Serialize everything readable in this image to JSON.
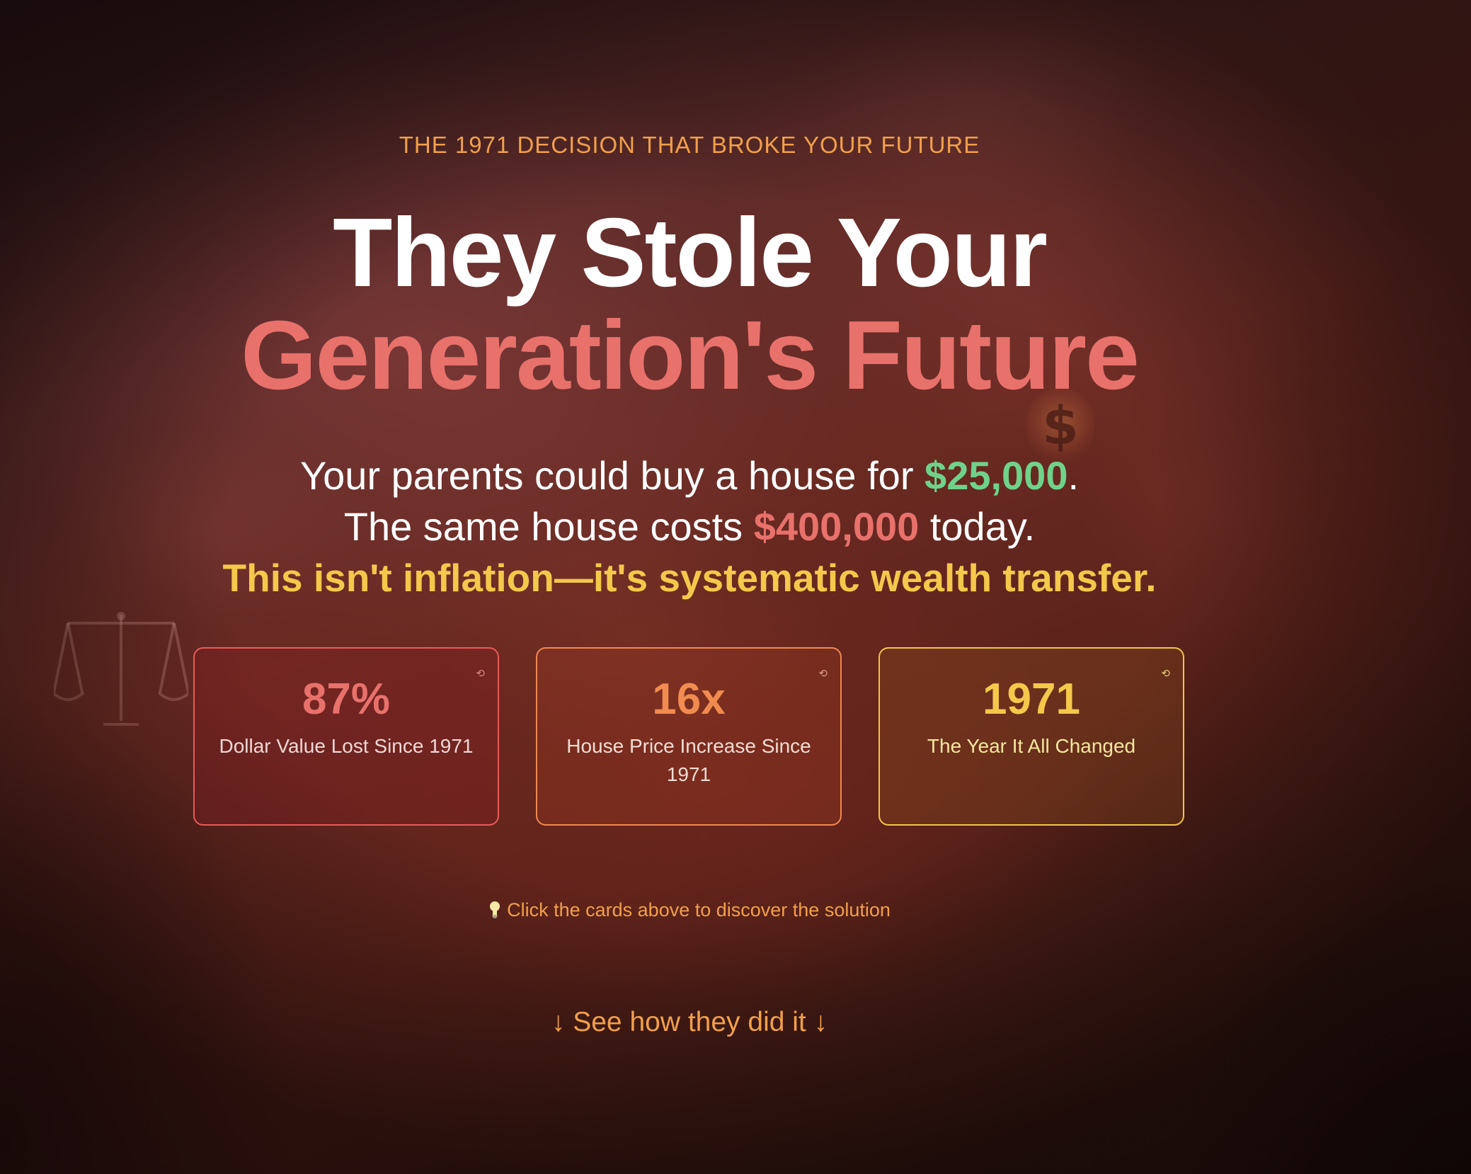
{
  "hero": {
    "eyebrow": "THE 1971 DECISION THAT BROKE YOUR FUTURE",
    "title_line1": "They Stole Your",
    "title_line2": "Generation's Future",
    "subtitle": {
      "line1_before": "Your parents could buy a house for ",
      "line1_price": "$25,000",
      "line1_after": ".",
      "line2_before": "The same house costs ",
      "line2_price": "$400,000",
      "line2_after": " today.",
      "line3": "This isn't inflation—it's systematic wealth transfer."
    }
  },
  "cards": [
    {
      "value": "87%",
      "label": "Dollar Value Lost Since 1971",
      "indicator_icon": "flip-icon",
      "accent": "#e8716c"
    },
    {
      "value": "16x",
      "label": "House Price Increase Since 1971",
      "indicator_icon": "flip-icon",
      "accent": "#f08c50"
    },
    {
      "value": "1971",
      "label": "The Year It All Changed",
      "indicator_icon": "flip-icon",
      "accent": "#f4c84a"
    }
  ],
  "hint": {
    "icon": "lightbulb-icon",
    "text": "Click the cards above to discover the solution"
  },
  "cta": {
    "text": "↓ See how they did it ↓"
  },
  "colors": {
    "accent_orange": "#f0a04b",
    "accent_red": "#e8716c",
    "accent_green": "#6fd28a",
    "accent_yellow": "#f4c84a"
  }
}
